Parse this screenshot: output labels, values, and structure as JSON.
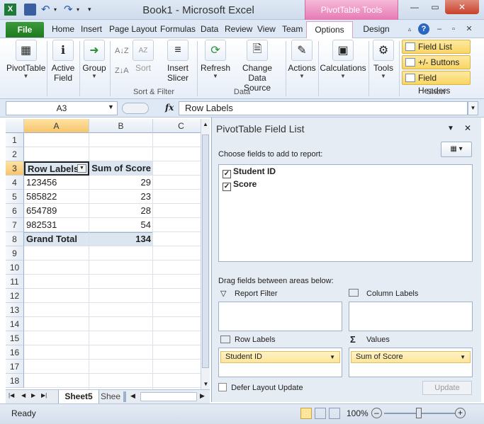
{
  "window": {
    "title": "Book1 - Microsoft Excel",
    "context_tab_group": "PivotTable Tools"
  },
  "ribbon_tabs": {
    "file": "File",
    "items": [
      "Home",
      "Insert",
      "Page Layout",
      "Formulas",
      "Data",
      "Review",
      "View",
      "Team"
    ],
    "options": "Options",
    "design": "Design"
  },
  "ribbon": {
    "pivottable": "PivotTable",
    "active_field_1": "Active",
    "active_field_2": "Field",
    "group": "Group",
    "sort": "Sort",
    "insert_slicer_1": "Insert",
    "insert_slicer_2": "Slicer",
    "refresh": "Refresh",
    "change_source_1": "Change Data",
    "change_source_2": "Source",
    "actions": "Actions",
    "calculations": "Calculations",
    "tools": "Tools",
    "field_list": "Field List",
    "buttons": "+/- Buttons",
    "field_headers": "Field Headers",
    "grp_sort_filter": "Sort & Filter",
    "grp_data": "Data",
    "grp_show": "Show"
  },
  "formula_bar": {
    "name_box": "A3",
    "fx": "fx",
    "content": "Row Labels"
  },
  "grid": {
    "columns": [
      "A",
      "B",
      "C"
    ],
    "rows": [
      "1",
      "2",
      "3",
      "4",
      "5",
      "6",
      "7",
      "8",
      "9",
      "10",
      "11",
      "12",
      "13",
      "14",
      "15",
      "16",
      "17",
      "18"
    ],
    "header_row": {
      "label": "Row Labels",
      "value": "Sum of Score"
    },
    "data": [
      {
        "id": "123456",
        "score": "29"
      },
      {
        "id": "585822",
        "score": "23"
      },
      {
        "id": "654789",
        "score": "28"
      },
      {
        "id": "982531",
        "score": "54"
      }
    ],
    "total": {
      "label": "Grand Total",
      "value": "134"
    }
  },
  "sheets": {
    "active": "Sheet5",
    "next": "Shee"
  },
  "status": {
    "ready": "Ready",
    "zoom": "100%"
  },
  "field_list": {
    "title": "PivotTable Field List",
    "choose": "Choose fields to add to report:",
    "fields": [
      "Student ID",
      "Score"
    ],
    "drag": "Drag fields between areas below:",
    "report_filter": "Report Filter",
    "column_labels": "Column Labels",
    "row_labels": "Row Labels",
    "values": "Values",
    "row_field": "Student ID",
    "value_field": "Sum of Score",
    "defer": "Defer Layout Update",
    "update": "Update"
  }
}
